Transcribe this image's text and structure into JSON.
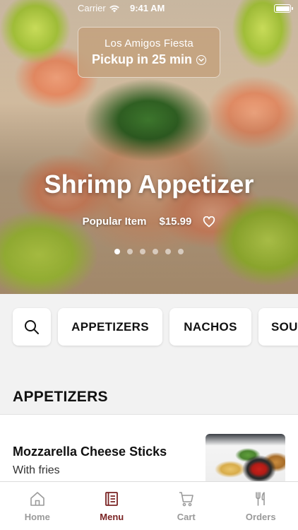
{
  "status_bar": {
    "carrier": "Carrier",
    "time": "9:41 AM"
  },
  "restaurant": {
    "name": "Los Amigos Fiesta",
    "pickup": "Pickup in 25 min"
  },
  "hero": {
    "title": "Shrimp Appetizer",
    "tag": "Popular Item",
    "price": "$15.99",
    "carousel_count": 6,
    "carousel_active": 1
  },
  "categories": {
    "items": [
      "APPETIZERS",
      "NACHOS",
      "SOU"
    ]
  },
  "section": {
    "title": "APPETIZERS"
  },
  "menu_item": {
    "name": "Mozzarella Cheese Sticks",
    "description": "With fries"
  },
  "tab_bar": {
    "home": "Home",
    "menu": "Menu",
    "cart": "Cart",
    "orders": "Orders",
    "active": "Menu",
    "active_color": "#7a2323",
    "inactive_color": "#9a9a9a"
  }
}
